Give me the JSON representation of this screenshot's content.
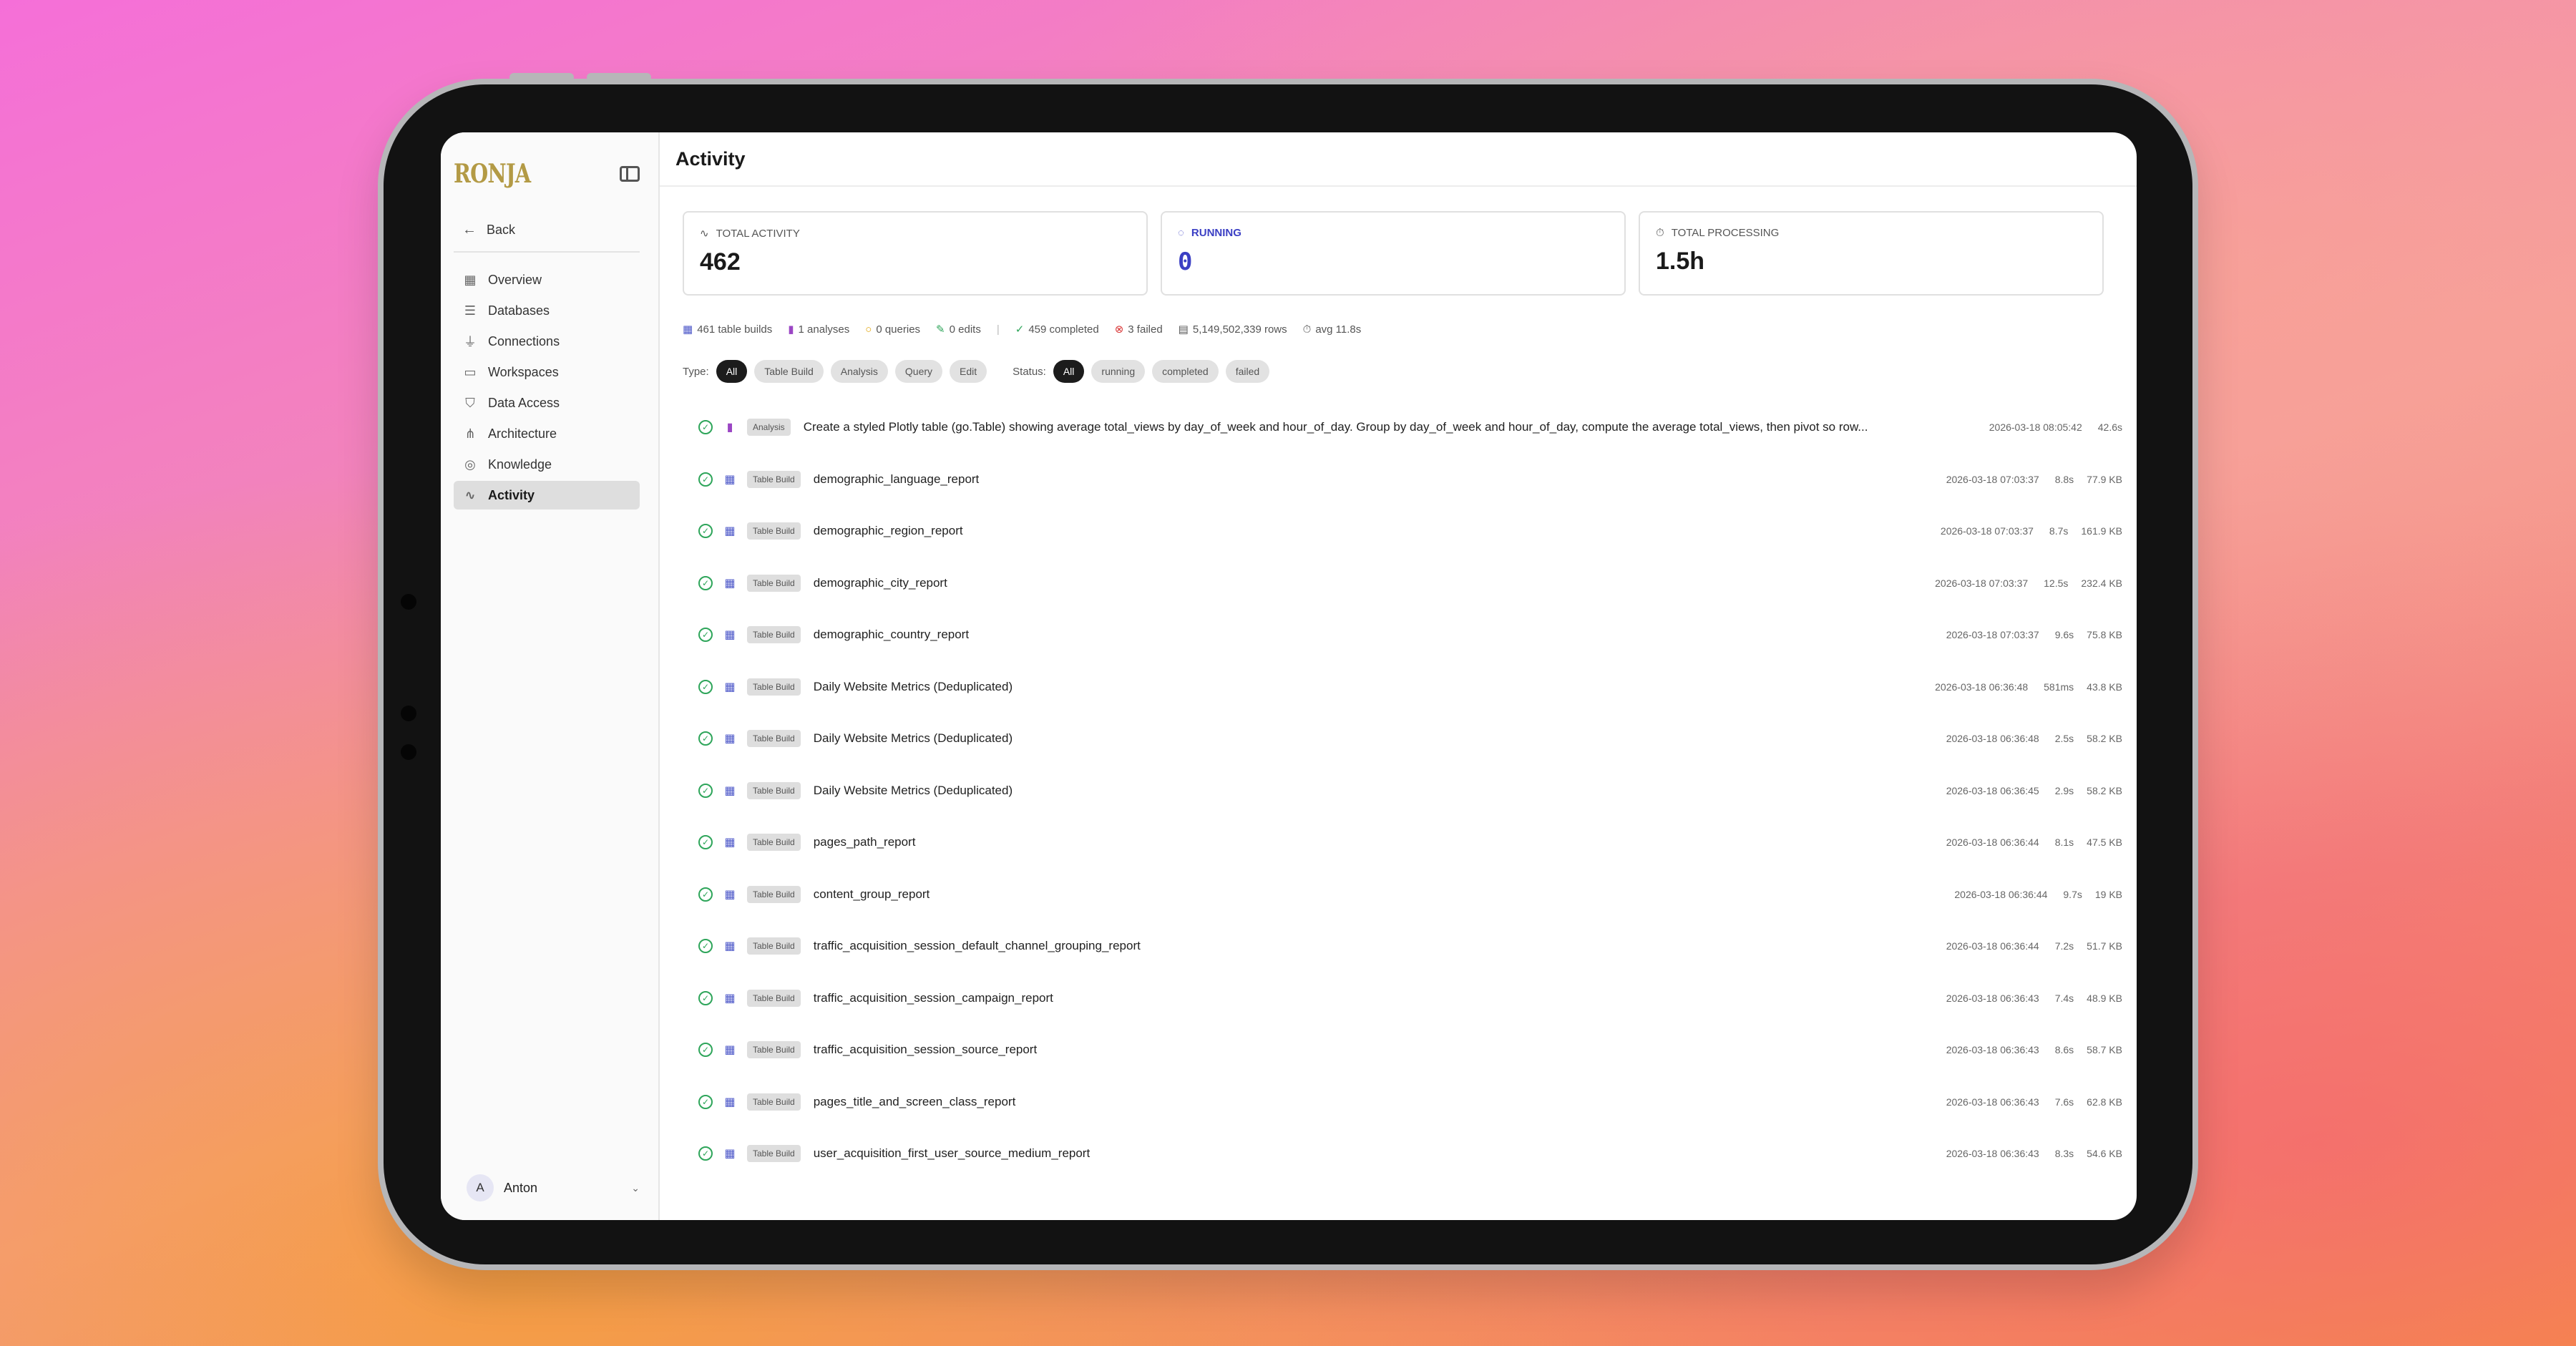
{
  "app": {
    "logo": "RONJA",
    "user_initial": "A",
    "user_name": "Anton"
  },
  "sidebar": {
    "back_label": "Back",
    "items": [
      {
        "label": "Overview",
        "icon": "grid-icon"
      },
      {
        "label": "Databases",
        "icon": "database-icon"
      },
      {
        "label": "Connections",
        "icon": "plug-icon"
      },
      {
        "label": "Workspaces",
        "icon": "folder-icon"
      },
      {
        "label": "Data Access",
        "icon": "shield-icon"
      },
      {
        "label": "Architecture",
        "icon": "architecture-icon"
      },
      {
        "label": "Knowledge",
        "icon": "compass-icon"
      },
      {
        "label": "Activity",
        "icon": "activity-icon",
        "active": true
      }
    ]
  },
  "page": {
    "title": "Activity"
  },
  "stats": {
    "total_activity": {
      "label": "Total Activity",
      "value": "462"
    },
    "running": {
      "label": "Running",
      "value": "0"
    },
    "total_processing": {
      "label": "Total Processing",
      "value": "1.5h"
    }
  },
  "summary": {
    "table_builds": "461 table builds",
    "analyses": "1 analyses",
    "queries": "0 queries",
    "edits": "0 edits",
    "completed": "459 completed",
    "failed": "3 failed",
    "rows": "5,149,502,339 rows",
    "avg": "avg 11.8s"
  },
  "filters": {
    "type_label": "Type:",
    "type_options": [
      "All",
      "Table Build",
      "Analysis",
      "Query",
      "Edit"
    ],
    "status_label": "Status:",
    "status_options": [
      "All",
      "running",
      "completed",
      "failed"
    ]
  },
  "rows": [
    {
      "type": "Analysis",
      "name": "Create a styled Plotly table (go.Table) showing average total_views by day_of_week and hour_of_day. Group by day_of_week and hour_of_day, compute the average total_views, then pivot so row...",
      "time": "2026-03-18 08:05:42",
      "duration": "42.6s",
      "size": ""
    },
    {
      "type": "Table Build",
      "name": "demographic_language_report",
      "time": "2026-03-18 07:03:37",
      "duration": "8.8s",
      "size": "77.9 KB"
    },
    {
      "type": "Table Build",
      "name": "demographic_region_report",
      "time": "2026-03-18 07:03:37",
      "duration": "8.7s",
      "size": "161.9 KB"
    },
    {
      "type": "Table Build",
      "name": "demographic_city_report",
      "time": "2026-03-18 07:03:37",
      "duration": "12.5s",
      "size": "232.4 KB"
    },
    {
      "type": "Table Build",
      "name": "demographic_country_report",
      "time": "2026-03-18 07:03:37",
      "duration": "9.6s",
      "size": "75.8 KB"
    },
    {
      "type": "Table Build",
      "name": "Daily Website Metrics (Deduplicated)",
      "time": "2026-03-18 06:36:48",
      "duration": "581ms",
      "size": "43.8 KB"
    },
    {
      "type": "Table Build",
      "name": "Daily Website Metrics (Deduplicated)",
      "time": "2026-03-18 06:36:48",
      "duration": "2.5s",
      "size": "58.2 KB"
    },
    {
      "type": "Table Build",
      "name": "Daily Website Metrics (Deduplicated)",
      "time": "2026-03-18 06:36:45",
      "duration": "2.9s",
      "size": "58.2 KB"
    },
    {
      "type": "Table Build",
      "name": "pages_path_report",
      "time": "2026-03-18 06:36:44",
      "duration": "8.1s",
      "size": "47.5 KB"
    },
    {
      "type": "Table Build",
      "name": "content_group_report",
      "time": "2026-03-18 06:36:44",
      "duration": "9.7s",
      "size": "19 KB"
    },
    {
      "type": "Table Build",
      "name": "traffic_acquisition_session_default_channel_grouping_report",
      "time": "2026-03-18 06:36:44",
      "duration": "7.2s",
      "size": "51.7 KB"
    },
    {
      "type": "Table Build",
      "name": "traffic_acquisition_session_campaign_report",
      "time": "2026-03-18 06:36:43",
      "duration": "7.4s",
      "size": "48.9 KB"
    },
    {
      "type": "Table Build",
      "name": "traffic_acquisition_session_source_report",
      "time": "2026-03-18 06:36:43",
      "duration": "8.6s",
      "size": "58.7 KB"
    },
    {
      "type": "Table Build",
      "name": "pages_title_and_screen_class_report",
      "time": "2026-03-18 06:36:43",
      "duration": "7.6s",
      "size": "62.8 KB"
    },
    {
      "type": "Table Build",
      "name": "user_acquisition_first_user_source_medium_report",
      "time": "2026-03-18 06:36:43",
      "duration": "8.3s",
      "size": "54.6 KB"
    }
  ],
  "colors": {
    "accent_blue": "#3b3fc4",
    "success_green": "#2ea55a",
    "logo_gold": "#b39a45"
  }
}
